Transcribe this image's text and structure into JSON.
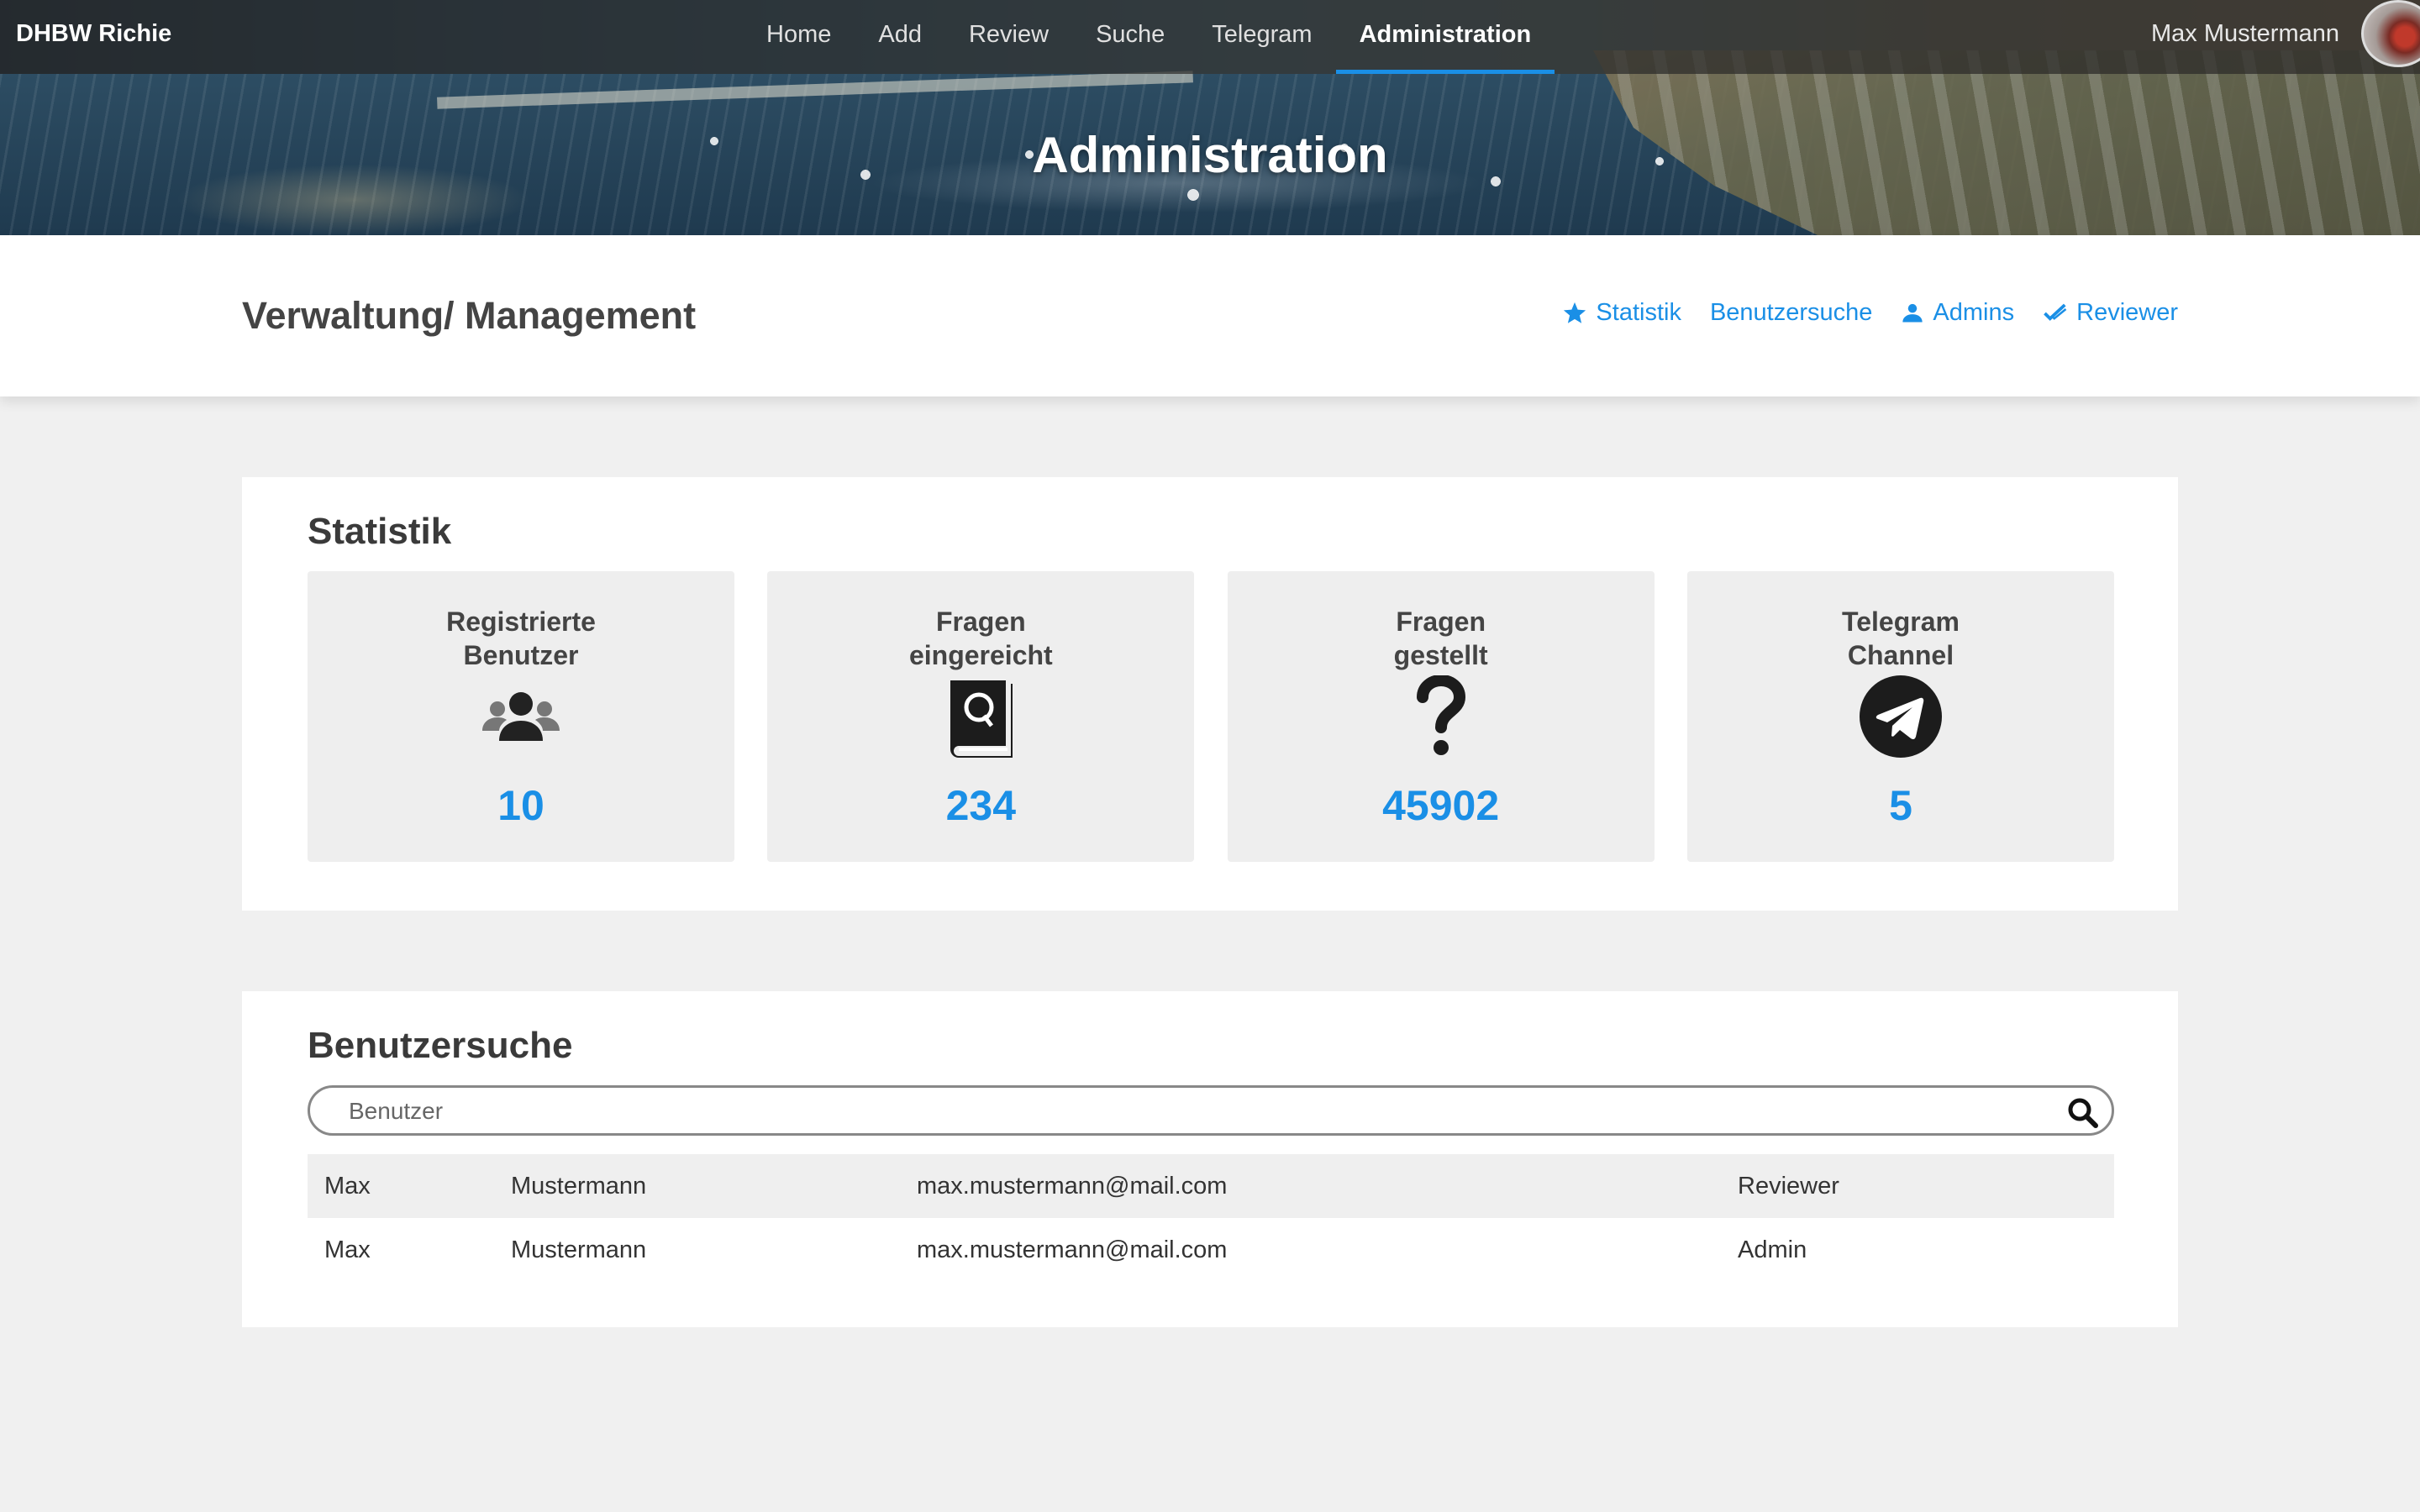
{
  "nav": {
    "brand": "DHBW Richie",
    "items": [
      {
        "label": "Home",
        "active": false
      },
      {
        "label": "Add",
        "active": false
      },
      {
        "label": "Review",
        "active": false
      },
      {
        "label": "Suche",
        "active": false
      },
      {
        "label": "Telegram",
        "active": false
      },
      {
        "label": "Administration",
        "active": true
      }
    ],
    "user_name": "Max Mustermann"
  },
  "hero": {
    "title": "Administration"
  },
  "subheader": {
    "title": "Verwaltung/ Management",
    "links": [
      {
        "label": "Statistik",
        "icon": "star-icon"
      },
      {
        "label": "Benutzersuche",
        "icon": ""
      },
      {
        "label": "Admins",
        "icon": "user-icon"
      },
      {
        "label": "Reviewer",
        "icon": "check-icon"
      }
    ]
  },
  "statistik": {
    "title": "Statistik",
    "tiles": [
      {
        "label_line1": "Registrierte",
        "label_line2": "Benutzer",
        "icon": "users-icon",
        "value": "10"
      },
      {
        "label_line1": "Fragen",
        "label_line2": "eingereicht",
        "icon": "question-book-icon",
        "value": "234"
      },
      {
        "label_line1": "Fragen",
        "label_line2": "gestellt",
        "icon": "question-mark-icon",
        "value": "45902"
      },
      {
        "label_line1": "Telegram",
        "label_line2": "Channel",
        "icon": "telegram-icon",
        "value": "5"
      }
    ]
  },
  "benutzersuche": {
    "title": "Benutzersuche",
    "search_placeholder": "Benutzer",
    "rows": [
      {
        "first": "Max",
        "last": "Mustermann",
        "email": "max.mustermann@mail.com",
        "role": "Reviewer"
      },
      {
        "first": "Max",
        "last": "Mustermann",
        "email": "max.mustermann@mail.com",
        "role": "Admin"
      }
    ]
  },
  "colors": {
    "accent": "#1a8fe6",
    "background": "#f0f0f0",
    "tile": "#eeeeee"
  }
}
